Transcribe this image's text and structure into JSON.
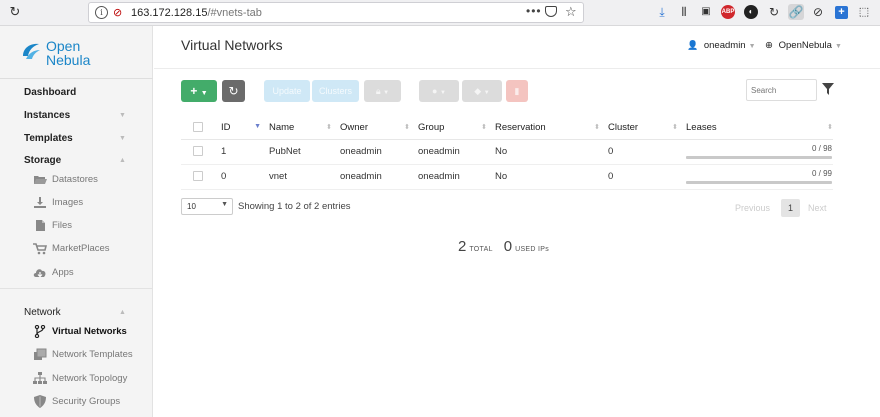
{
  "browser": {
    "url_host": "163.172.128.15",
    "url_path": "/#vnets-tab",
    "more_glyph": "•••"
  },
  "logo": {
    "line1": "Open",
    "line2": "Nebula"
  },
  "sidebar": {
    "dashboard": "Dashboard",
    "instances": "Instances",
    "templates": "Templates",
    "storage": "Storage",
    "storage_items": [
      "Datastores",
      "Images",
      "Files",
      "MarketPlaces",
      "Apps"
    ],
    "network": "Network",
    "network_items": [
      "Virtual Networks",
      "Network Templates",
      "Network Topology",
      "Security Groups"
    ]
  },
  "header": {
    "title": "Virtual Networks",
    "user": "oneadmin",
    "zone": "OpenNebula"
  },
  "toolbar": {
    "add": "+",
    "update": "Update",
    "clusters": "Clusters",
    "search_placeholder": "Search"
  },
  "table": {
    "columns": [
      "ID",
      "Name",
      "Owner",
      "Group",
      "Reservation",
      "Cluster",
      "Leases"
    ],
    "rows": [
      {
        "id": "1",
        "name": "PubNet",
        "owner": "oneadmin",
        "group": "oneadmin",
        "reservation": "No",
        "cluster": "0",
        "leases": "0 / 98",
        "lease_fraction": 0
      },
      {
        "id": "0",
        "name": "vnet",
        "owner": "oneadmin",
        "group": "oneadmin",
        "reservation": "No",
        "cluster": "0",
        "leases": "0 / 99",
        "lease_fraction": 0
      }
    ]
  },
  "footer": {
    "page_length": "10",
    "entries_text": "Showing 1 to 2 of 2 entries",
    "previous": "Previous",
    "page": "1",
    "next": "Next"
  },
  "totals": {
    "total_value": "2",
    "total_label": "TOTAL",
    "used_value": "0",
    "used_label": "USED IPs"
  },
  "colors": {
    "add_button": "#43ac6a",
    "refresh_button": "#6b6b6b",
    "brand": "#1b86c8",
    "lease_bar": "#c9c9c9"
  }
}
